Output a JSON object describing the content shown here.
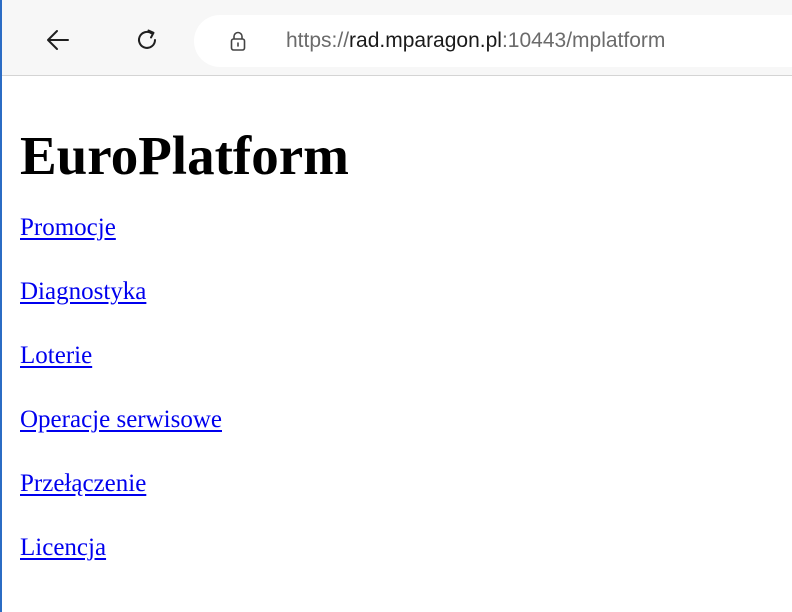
{
  "browser": {
    "back_icon": "arrow-left-icon",
    "reload_icon": "refresh-icon",
    "lock_icon": "lock-icon",
    "url": {
      "scheme": "https://",
      "host": "rad.mparagon.pl",
      "rest": ":10443/mplatform"
    }
  },
  "page": {
    "title": "EuroPlatform",
    "link_color": "#0000ee",
    "links": [
      {
        "label": "Promocje"
      },
      {
        "label": "Diagnostyka"
      },
      {
        "label": "Loterie"
      },
      {
        "label": "Operacje serwisowe"
      },
      {
        "label": "Przełączenie"
      },
      {
        "label": "Licencja"
      }
    ]
  }
}
